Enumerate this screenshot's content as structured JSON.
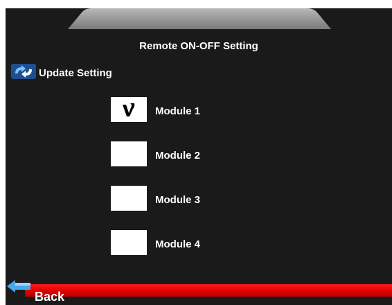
{
  "screen": {
    "title": "Remote ON-OFF Setting"
  },
  "update": {
    "label": "Update Setting",
    "icon": "refresh-icon"
  },
  "modules": [
    {
      "label": "Module 1",
      "checked": true,
      "mark": "ν"
    },
    {
      "label": "Module 2",
      "checked": false,
      "mark": ""
    },
    {
      "label": "Module 3",
      "checked": false,
      "mark": ""
    },
    {
      "label": "Module 4",
      "checked": false,
      "mark": ""
    }
  ],
  "footer": {
    "back_label": "Back",
    "back_icon": "back-arrow-icon",
    "bar_color": "#e00000"
  }
}
